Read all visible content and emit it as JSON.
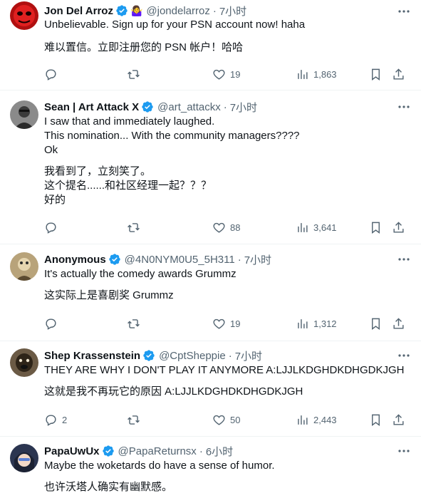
{
  "colors": {
    "verified": "#1d9bf0",
    "secondary": "#536471",
    "text": "#0f1419",
    "divider": "#eff3f4"
  },
  "tweets": [
    {
      "name": "Jon Del Arroz",
      "extra_badge": "🤷‍♀️",
      "handle": "@jondelarroz",
      "time": "7小时",
      "text": "Unbelievable.  Sign up for your PSN account now! haha",
      "translation": "难以置信。立即注册您的 PSN 帐户！哈哈",
      "replies": "",
      "retweets": "",
      "likes": "19",
      "views": "1,863",
      "avatar_icon": "red-mask-avatar"
    },
    {
      "name": "Sean | Art Attack X",
      "handle": "@art_attackx",
      "time": "7小时",
      "text": "I saw that and immediately laughed.\nThis nomination... With the community managers????\nOk",
      "translation": "我看到了，立刻笑了。\n这个提名......和社区经理一起？？？\n好的",
      "replies": "",
      "retweets": "",
      "likes": "88",
      "views": "3,641",
      "avatar_icon": "photo-avatar"
    },
    {
      "name": "Anonymous",
      "handle": "@4N0NYM0U5_5H311",
      "time": "7小时",
      "text": "It's actually the comedy awards Grummz",
      "translation": "这实际上是喜剧奖 Grummz",
      "replies": "",
      "retweets": "",
      "likes": "19",
      "views": "1,312",
      "avatar_icon": "cartoon-avatar"
    },
    {
      "name": "Shep Krassenstein",
      "handle": "@CptSheppie",
      "time": "7小时",
      "text": "THEY ARE WHY I DON'T PLAY IT ANYMORE A:LJJLKDGHDKDHGDKJGH",
      "translation": "这就是我不再玩它的原因 A:LJJLKDGHDKDHGDKJGH",
      "replies": "2",
      "retweets": "",
      "likes": "50",
      "views": "2,443",
      "avatar_icon": "dog-avatar"
    },
    {
      "name": "PapaUwUx",
      "handle": "@PapaReturnsx",
      "time": "6小时",
      "text": "Maybe the woketards do have a sense of humor.",
      "translation": "也许沃塔人确实有幽默感。",
      "avatar_icon": "anime-avatar"
    }
  ]
}
